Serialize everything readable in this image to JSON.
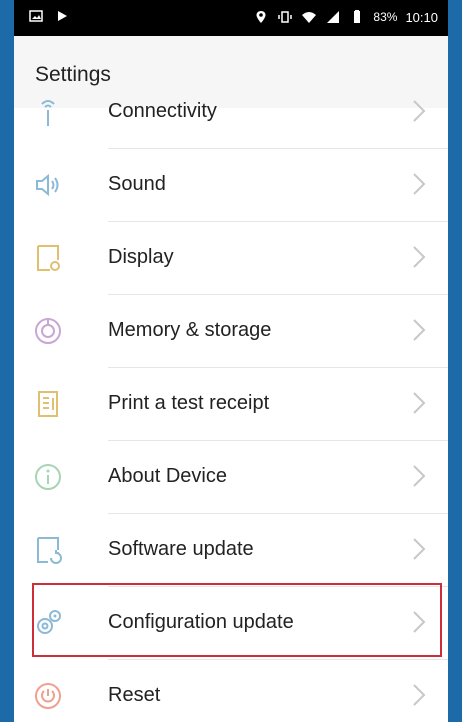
{
  "status_bar": {
    "battery": "83%",
    "time": "10:10"
  },
  "header": {
    "title": "Settings"
  },
  "items": [
    {
      "label": "Connectivity",
      "icon": "connectivity-icon"
    },
    {
      "label": "Sound",
      "icon": "sound-icon"
    },
    {
      "label": "Display",
      "icon": "display-icon"
    },
    {
      "label": "Memory & storage",
      "icon": "memory-storage-icon"
    },
    {
      "label": "Print a test receipt",
      "icon": "receipt-icon"
    },
    {
      "label": "About Device",
      "icon": "info-icon"
    },
    {
      "label": "Software update",
      "icon": "software-update-icon"
    },
    {
      "label": "Configuration update",
      "icon": "config-gear-icon"
    },
    {
      "label": "Reset",
      "icon": "reset-power-icon"
    }
  ],
  "highlight_color": "#cc2f3a",
  "icon_color": "#8bb9d6"
}
